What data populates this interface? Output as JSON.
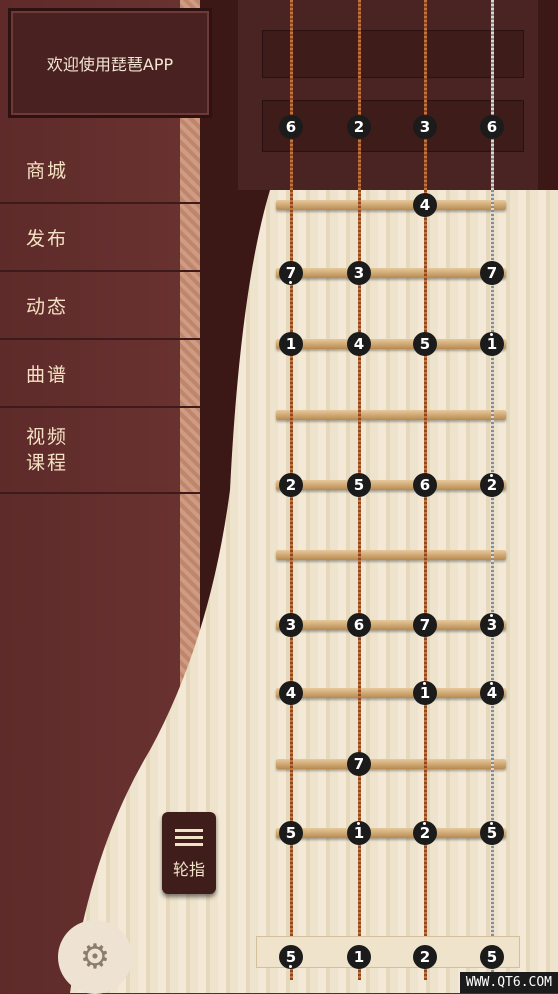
{
  "header": {
    "welcome_text": "欢迎使用琵琶APP"
  },
  "menu": [
    {
      "id": "shop",
      "label": "商城"
    },
    {
      "id": "publish",
      "label": "发布"
    },
    {
      "id": "feed",
      "label": "动态"
    },
    {
      "id": "score",
      "label": "曲谱"
    },
    {
      "id": "video",
      "label": "视频\n课程"
    }
  ],
  "controls": {
    "fingering_label": "轮指",
    "settings_icon": "gear-icon"
  },
  "watermark": "WWW.QT6.COM",
  "instrument": {
    "string_colors": [
      "copper",
      "copper",
      "copper",
      "silver"
    ],
    "notes": [
      {
        "s": 0,
        "row": "nut",
        "v": "6",
        "dot": ""
      },
      {
        "s": 1,
        "row": "nut",
        "v": "2",
        "dot": ""
      },
      {
        "s": 2,
        "row": "nut",
        "v": "3",
        "dot": ""
      },
      {
        "s": 3,
        "row": "nut",
        "v": "6",
        "dot": ""
      },
      {
        "s": 2,
        "row": "f1",
        "v": "4",
        "dot": ""
      },
      {
        "s": 0,
        "row": "f2",
        "v": "7",
        "dot": "bottom"
      },
      {
        "s": 1,
        "row": "f2",
        "v": "3",
        "dot": ""
      },
      {
        "s": 3,
        "row": "f2",
        "v": "7",
        "dot": ""
      },
      {
        "s": 0,
        "row": "f3",
        "v": "1",
        "dot": ""
      },
      {
        "s": 1,
        "row": "f3",
        "v": "4",
        "dot": ""
      },
      {
        "s": 2,
        "row": "f3",
        "v": "5",
        "dot": ""
      },
      {
        "s": 3,
        "row": "f3",
        "v": "1",
        "dot": "top"
      },
      {
        "s": 0,
        "row": "f5",
        "v": "2",
        "dot": ""
      },
      {
        "s": 1,
        "row": "f5",
        "v": "5",
        "dot": ""
      },
      {
        "s": 2,
        "row": "f5",
        "v": "6",
        "dot": ""
      },
      {
        "s": 3,
        "row": "f5",
        "v": "2",
        "dot": "top"
      },
      {
        "s": 0,
        "row": "f7",
        "v": "3",
        "dot": ""
      },
      {
        "s": 1,
        "row": "f7",
        "v": "6",
        "dot": ""
      },
      {
        "s": 2,
        "row": "f7",
        "v": "7",
        "dot": ""
      },
      {
        "s": 3,
        "row": "f7",
        "v": "3",
        "dot": "top"
      },
      {
        "s": 0,
        "row": "f8",
        "v": "4",
        "dot": ""
      },
      {
        "s": 2,
        "row": "f8",
        "v": "1",
        "dot": "top"
      },
      {
        "s": 3,
        "row": "f8",
        "v": "4",
        "dot": "top"
      },
      {
        "s": 1,
        "row": "f9",
        "v": "7",
        "dot": ""
      },
      {
        "s": 0,
        "row": "f10",
        "v": "5",
        "dot": ""
      },
      {
        "s": 1,
        "row": "f10",
        "v": "1",
        "dot": "top"
      },
      {
        "s": 2,
        "row": "f10",
        "v": "2",
        "dot": "top"
      },
      {
        "s": 3,
        "row": "f10",
        "v": "5",
        "dot": "top"
      },
      {
        "s": 0,
        "row": "bottom",
        "v": "5",
        "dot": "bottom"
      },
      {
        "s": 1,
        "row": "bottom",
        "v": "1",
        "dot": ""
      },
      {
        "s": 2,
        "row": "bottom",
        "v": "2",
        "dot": ""
      },
      {
        "s": 3,
        "row": "bottom",
        "v": "5",
        "dot": ""
      }
    ]
  }
}
